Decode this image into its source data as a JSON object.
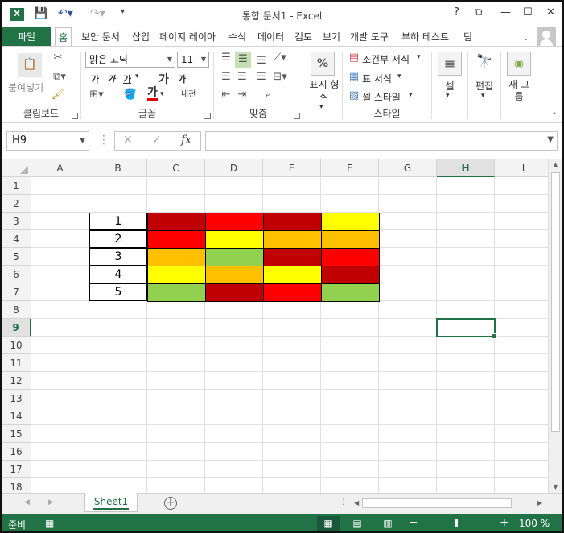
{
  "app": {
    "title": "통합 문서1 - Excel",
    "logo": "X",
    "window_buttons": [
      "?",
      "⧉",
      "—",
      "☐",
      "✕"
    ]
  },
  "tabs": {
    "file": "파일",
    "items": [
      "홈",
      "보안 문서",
      "삽입",
      "페이지 레이아",
      "수식",
      "데이터",
      "검토",
      "보기",
      "개발 도구",
      "부하 테스트",
      "팀"
    ],
    "active": "홈",
    "more": "."
  },
  "ribbon": {
    "clipboard": {
      "paste_label": "붙여넣기",
      "group_label": "클립보드"
    },
    "font": {
      "font_name": "맑은 고딕",
      "font_size": "11",
      "bold": "가",
      "italic": "가",
      "underline": "가",
      "grow": "가",
      "shrink": "가",
      "phonetic": "내천",
      "group_label": "글꼴"
    },
    "alignment": {
      "group_label": "맞춤"
    },
    "number": {
      "label": "표시 형식",
      "group_label": "표시 형식"
    },
    "styles": {
      "conditional": "조건부 서식",
      "table": "표 서식",
      "cell_style": "셀 스타일",
      "group_label": "스타일"
    },
    "cells": {
      "label": "셀"
    },
    "editing": {
      "label": "편집"
    },
    "new_group": {
      "label": "새 그룹"
    }
  },
  "formula_bar": {
    "name_box": "H9",
    "fx": "fx",
    "formula": ""
  },
  "sheet": {
    "columns": [
      "A",
      "B",
      "C",
      "D",
      "E",
      "F",
      "G",
      "H",
      "I"
    ],
    "rows": [
      "1",
      "2",
      "3",
      "4",
      "5",
      "6",
      "7",
      "8",
      "9",
      "10",
      "11",
      "12",
      "13",
      "14",
      "15",
      "16",
      "17",
      "18"
    ],
    "selected_column": "H",
    "selected_row": "9",
    "row_numbers": [
      "1",
      "2",
      "3",
      "4",
      "5"
    ],
    "colors": {
      "dark_red": "#c00000",
      "red": "#ff0000",
      "orange": "#ffc000",
      "yellow": "#ffff00",
      "green": "#92d050"
    },
    "color_grid": [
      [
        "dark_red",
        "red",
        "dark_red",
        "yellow"
      ],
      [
        "red",
        "yellow",
        "orange",
        "orange"
      ],
      [
        "orange",
        "green",
        "dark_red",
        "red"
      ],
      [
        "yellow",
        "orange",
        "yellow",
        "dark_red"
      ],
      [
        "green",
        "dark_red",
        "red",
        "green"
      ]
    ]
  },
  "sheet_tabs": {
    "active": "Sheet1",
    "add": "+"
  },
  "status": {
    "ready": "준비",
    "zoom": "100 %",
    "minus": "−",
    "plus": "+"
  }
}
